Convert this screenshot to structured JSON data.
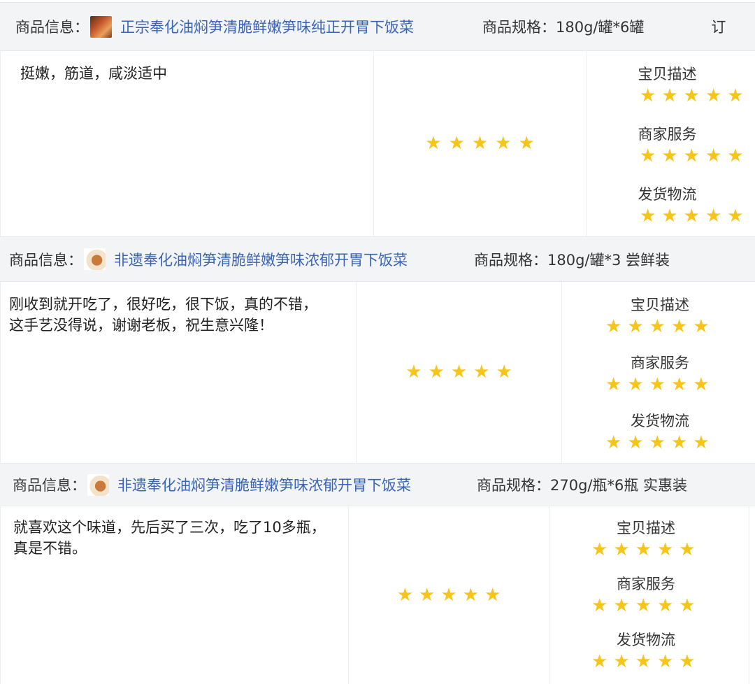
{
  "colors": {
    "star": "#f7c519",
    "link": "#3a64b8",
    "header_bg": "#f3f4f6"
  },
  "reviews": [
    {
      "header": {
        "info_label": "商品信息：",
        "thumb_icon": "product-thumbnail",
        "title": "正宗奉化油焖笋清脆鲜嫩笋味纯正开胃下饭菜",
        "spec_label": "商品规格：",
        "spec_value": "180g/罐*6罐",
        "trailing": "订"
      },
      "comment": "挺嫩，筋道，咸淡适中",
      "overall_rating": 5,
      "dimensions": [
        {
          "label": "宝贝描述",
          "rating": 5
        },
        {
          "label": "商家服务",
          "rating": 5
        },
        {
          "label": "发货物流",
          "rating": 5
        }
      ]
    },
    {
      "header": {
        "info_label": "商品信息：",
        "thumb_icon": "product-thumbnail",
        "title": "非遗奉化油焖笋清脆鲜嫩笋味浓郁开胃下饭菜",
        "spec_label": "商品规格：",
        "spec_value": "180g/罐*3 尝鲜装",
        "trailing": ""
      },
      "comment": "刚收到就开吃了，很好吃，很下饭，真的不错，\n这手艺没得说，谢谢老板，祝生意兴隆！",
      "overall_rating": 5,
      "dimensions": [
        {
          "label": "宝贝描述",
          "rating": 5
        },
        {
          "label": "商家服务",
          "rating": 5
        },
        {
          "label": "发货物流",
          "rating": 5
        }
      ]
    },
    {
      "header": {
        "info_label": "商品信息：",
        "thumb_icon": "product-thumbnail",
        "title": "非遗奉化油焖笋清脆鲜嫩笋味浓郁开胃下饭菜",
        "spec_label": "商品规格：",
        "spec_value": "270g/瓶*6瓶 实惠装",
        "trailing": ""
      },
      "comment": "就喜欢这个味道，先后买了三次，吃了10多瓶，\n真是不错。",
      "overall_rating": 5,
      "dimensions": [
        {
          "label": "宝贝描述",
          "rating": 5
        },
        {
          "label": "商家服务",
          "rating": 5
        },
        {
          "label": "发货物流",
          "rating": 5
        }
      ]
    }
  ]
}
